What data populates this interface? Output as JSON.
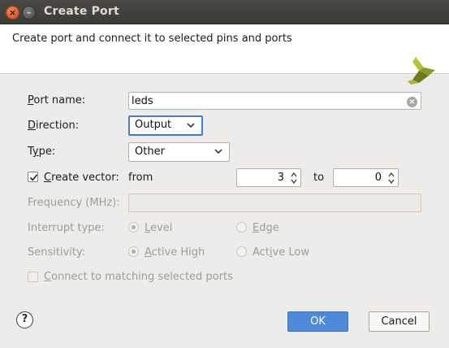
{
  "window": {
    "title": "Create Port",
    "close_glyph": "×",
    "minimize_glyph": "–"
  },
  "header": {
    "description": "Create port and connect it to selected pins and ports",
    "logo": "vivado-logo-icon"
  },
  "form": {
    "port_name": {
      "label_pre": "",
      "label_key": "P",
      "label_post": "ort name:",
      "value": "leds"
    },
    "direction": {
      "label_pre": "",
      "label_key": "D",
      "label_post": "irection:",
      "value": "Output"
    },
    "type": {
      "label_pre": "T",
      "label_key": "y",
      "label_post": "pe:",
      "value": "Other"
    },
    "create_vector": {
      "label_pre": "",
      "label_key": "C",
      "label_post": "reate vector:",
      "checked": true,
      "from_label": "from",
      "from_value": "3",
      "to_label": "to",
      "to_value": "0"
    },
    "frequency": {
      "label": "Frequency (MHz):",
      "value": ""
    },
    "interrupt_type": {
      "label": "Interrupt type:",
      "options": [
        {
          "pre": "",
          "key": "L",
          "post": "evel",
          "selected": true
        },
        {
          "pre": "",
          "key": "E",
          "post": "dge",
          "selected": false
        }
      ]
    },
    "sensitivity": {
      "label": "Sensitivity:",
      "options": [
        {
          "pre": "",
          "key": "A",
          "post": "ctive High",
          "selected": true
        },
        {
          "pre": "Act",
          "key": "i",
          "post": "ve Low",
          "selected": false
        }
      ]
    },
    "connect_matching": {
      "pre": "",
      "key": "C",
      "post": "onnect to matching selected ports",
      "checked": false
    }
  },
  "buttons": {
    "help": "?",
    "ok": "OK",
    "cancel": "Cancel"
  },
  "colors": {
    "accent": "#4d8ad8",
    "titlebar": "#3c3b37",
    "focus": "#3f7fcf",
    "logo_dark": "#6b7a1e",
    "logo_light": "#b5c43a"
  }
}
